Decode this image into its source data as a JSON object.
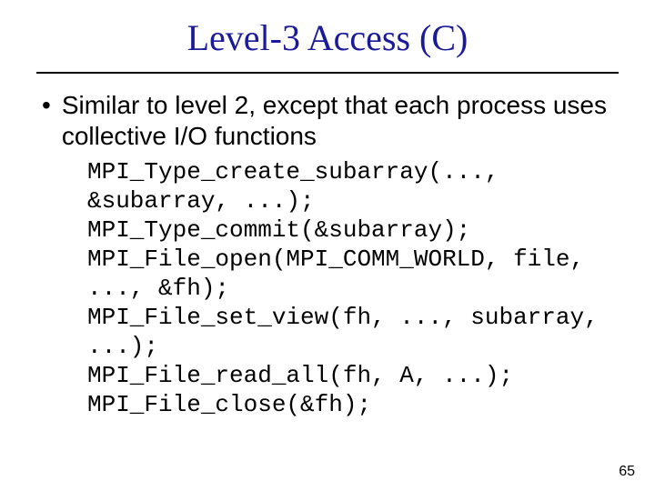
{
  "title": "Level-3 Access (C)",
  "bullet": "Similar to level 2, except that each process uses collective I/O functions",
  "code": "MPI_Type_create_subarray(...,\n&subarray, ...);\nMPI_Type_commit(&subarray);\nMPI_File_open(MPI_COMM_WORLD, file,\n..., &fh);\nMPI_File_set_view(fh, ..., subarray,\n...);\nMPI_File_read_all(fh, A, ...);\nMPI_File_close(&fh);",
  "page_number": "65"
}
